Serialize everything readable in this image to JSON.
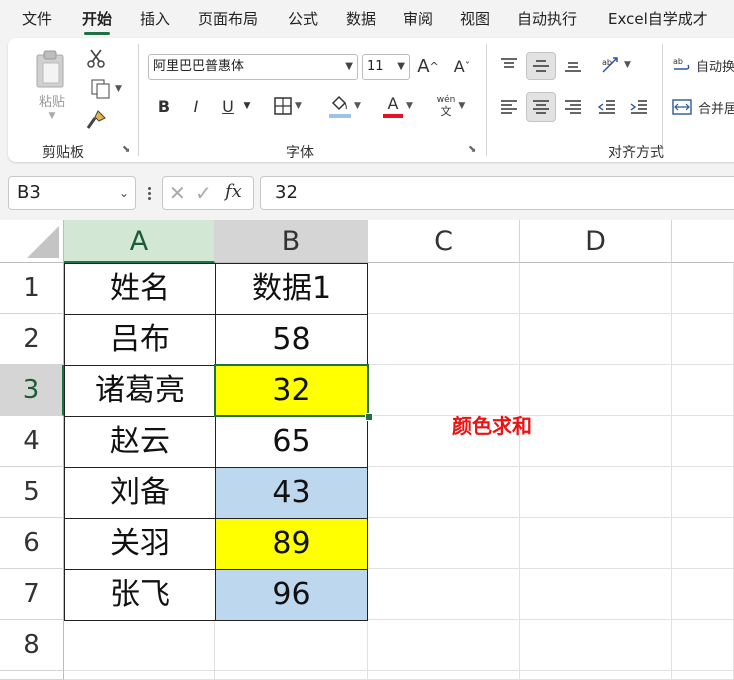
{
  "menu_tabs": [
    "文件",
    "开始",
    "插入",
    "页面布局",
    "公式",
    "数据",
    "审阅",
    "视图",
    "自动执行",
    "Excel自学成才"
  ],
  "active_tab": "开始",
  "ribbon": {
    "clipboard": {
      "paste_label": "粘贴",
      "group_label": "剪贴板"
    },
    "font": {
      "font_name": "阿里巴巴普惠体",
      "font_size": "11",
      "grow_font": "A^",
      "shrink_font": "A˅",
      "bold": "B",
      "italic": "I",
      "underline": "U",
      "font_color_glyph": "A",
      "phonetic_top": "wén",
      "phonetic_bottom": "文",
      "group_label": "字体",
      "fill_color": "#9dc3e6",
      "font_color": "#e81123"
    },
    "alignment": {
      "wrap_text": "自动换",
      "merge_center": "合并居",
      "group_label": "对齐方式"
    }
  },
  "formula_bar": {
    "name_box": "B3",
    "fx": "fx",
    "formula": "32"
  },
  "sheet": {
    "columns": [
      "A",
      "B",
      "C",
      "D"
    ],
    "rows": [
      "1",
      "2",
      "3",
      "4",
      "5",
      "6",
      "7",
      "8"
    ],
    "selected_cell": "B3",
    "table": [
      {
        "name": "姓名",
        "value": "数据1",
        "fill": "#ffffff"
      },
      {
        "name": "吕布",
        "value": "58",
        "fill": "#ffffff"
      },
      {
        "name": "诸葛亮",
        "value": "32",
        "fill": "#ffff00"
      },
      {
        "name": "赵云",
        "value": "65",
        "fill": "#ffffff"
      },
      {
        "name": "刘备",
        "value": "43",
        "fill": "#bdd7ee"
      },
      {
        "name": "关羽",
        "value": "89",
        "fill": "#ffff00"
      },
      {
        "name": "张飞",
        "value": "96",
        "fill": "#bdd7ee"
      }
    ],
    "note": "颜色求和",
    "note_color": "#ee1111"
  },
  "colors": {
    "accent": "#1e7145",
    "ribbon_bg": "#f3f3f3"
  }
}
